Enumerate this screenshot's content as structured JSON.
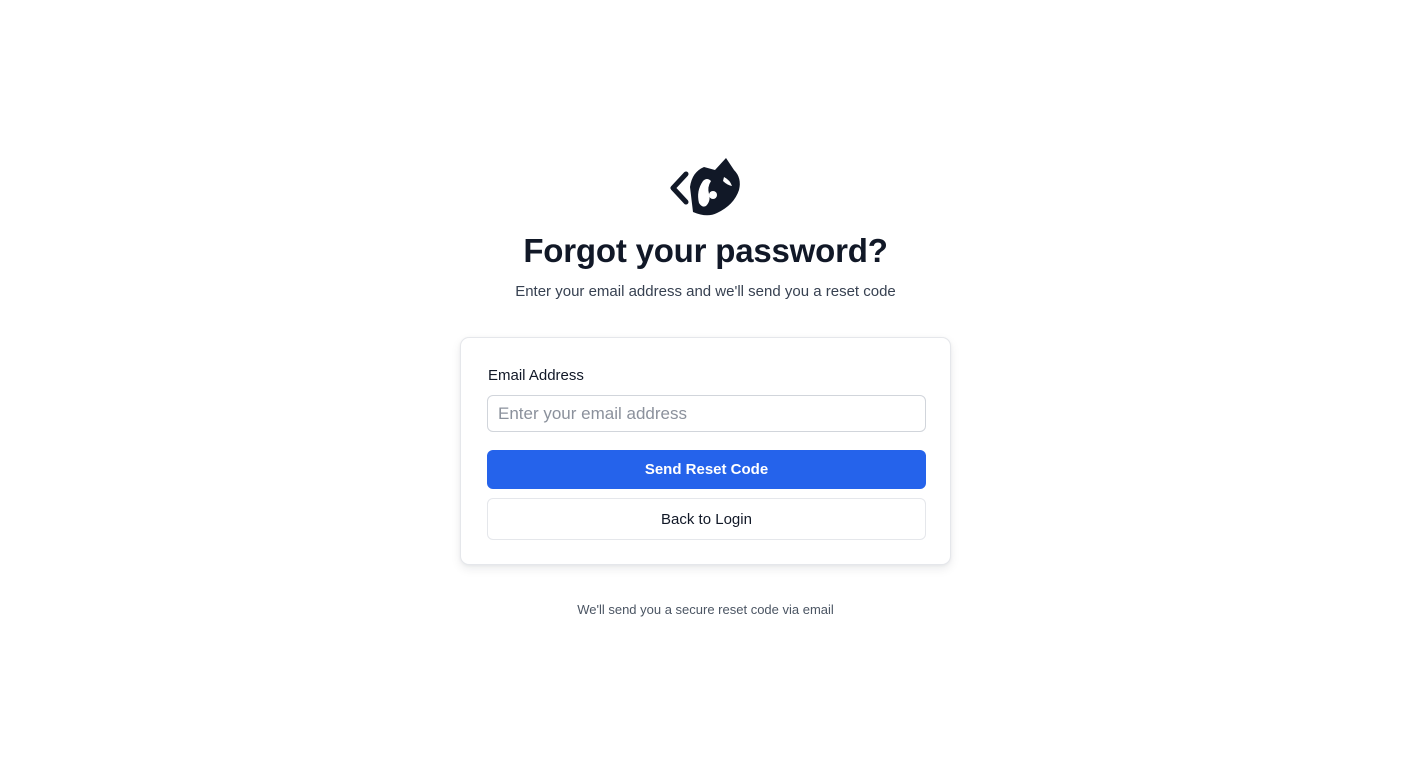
{
  "brand": {
    "logo_icon": "raccoon-code-logo-icon",
    "logo_color": "#111827"
  },
  "header": {
    "title": "Forgot your password?",
    "subtitle": "Enter your email address and we'll send you a reset code"
  },
  "form": {
    "email_label": "Email Address",
    "email_value": "",
    "email_placeholder": "Enter your email address",
    "submit_label": "Send Reset Code",
    "back_label": "Back to Login",
    "accent_color": "#2563eb"
  },
  "footer": {
    "note": "We'll send you a secure reset code via email"
  }
}
